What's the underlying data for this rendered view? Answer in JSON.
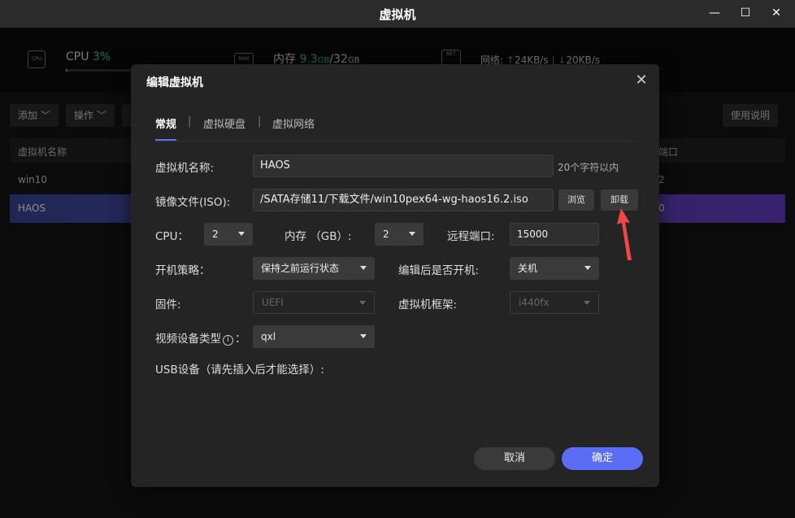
{
  "window": {
    "title": "虚拟机",
    "minimize": "—",
    "maximize": "☐",
    "close": "✕"
  },
  "stats": {
    "cpu": {
      "label": "CPU",
      "value": "3%",
      "chip": "CPU",
      "usage_fraction": 0.03
    },
    "mem": {
      "label": "内存",
      "used": "9.3",
      "used_unit": "GB",
      "sep": "/",
      "total": "32",
      "total_unit": "GB",
      "chip": "RAM"
    },
    "net": {
      "label": "网络:",
      "up": "24KB/s",
      "down": "20KB/s",
      "sep": "|",
      "chip": "NET"
    }
  },
  "toolbar": {
    "add": "添加",
    "ops": "操作",
    "help": "使用说明"
  },
  "table": {
    "col_name": "虚拟机名称",
    "col_right_partial": "端口",
    "rows": [
      {
        "name": "win10",
        "right": "2"
      },
      {
        "name": "HAOS",
        "right": "0"
      }
    ]
  },
  "dialog": {
    "title": "编辑虚拟机",
    "tabs": [
      "常规",
      "虚拟硬盘",
      "虚拟网络"
    ],
    "tab_sep": "|",
    "name_label": "虚拟机名称:",
    "name_value": "HAOS",
    "name_hint": "20个字符以内",
    "iso_label": "镜像文件(ISO):",
    "iso_value": "/SATA存储11/下载文件/win10pex64-wg-haos16.2.iso",
    "browse": "浏览",
    "unmount": "卸载",
    "cpu_label": "CPU：",
    "cpu_value": "2",
    "mem_label": "内存 （GB）:",
    "mem_value": "2",
    "port_label": "远程端口:",
    "port_value": "15000",
    "boot_label": "开机策略：",
    "boot_value": "保持之前运行状态",
    "after_edit_label": "编辑后是否开机:",
    "after_edit_value": "关机",
    "firmware_label": "固件:",
    "firmware_value": "UEFI",
    "arch_label": "虚拟机框架:",
    "arch_value": "i440fx",
    "video_label_pre": "视频设备类型",
    "video_label_post": "：",
    "video_info_icon": "i",
    "video_value": "qxl",
    "usb_label": "USB设备（请先插入后才能选择）:",
    "cancel": "取消",
    "ok": "确定"
  },
  "colors": {
    "accent": "#2ec4b6",
    "primary": "#5b6cf5",
    "arrow": "#f04848"
  }
}
